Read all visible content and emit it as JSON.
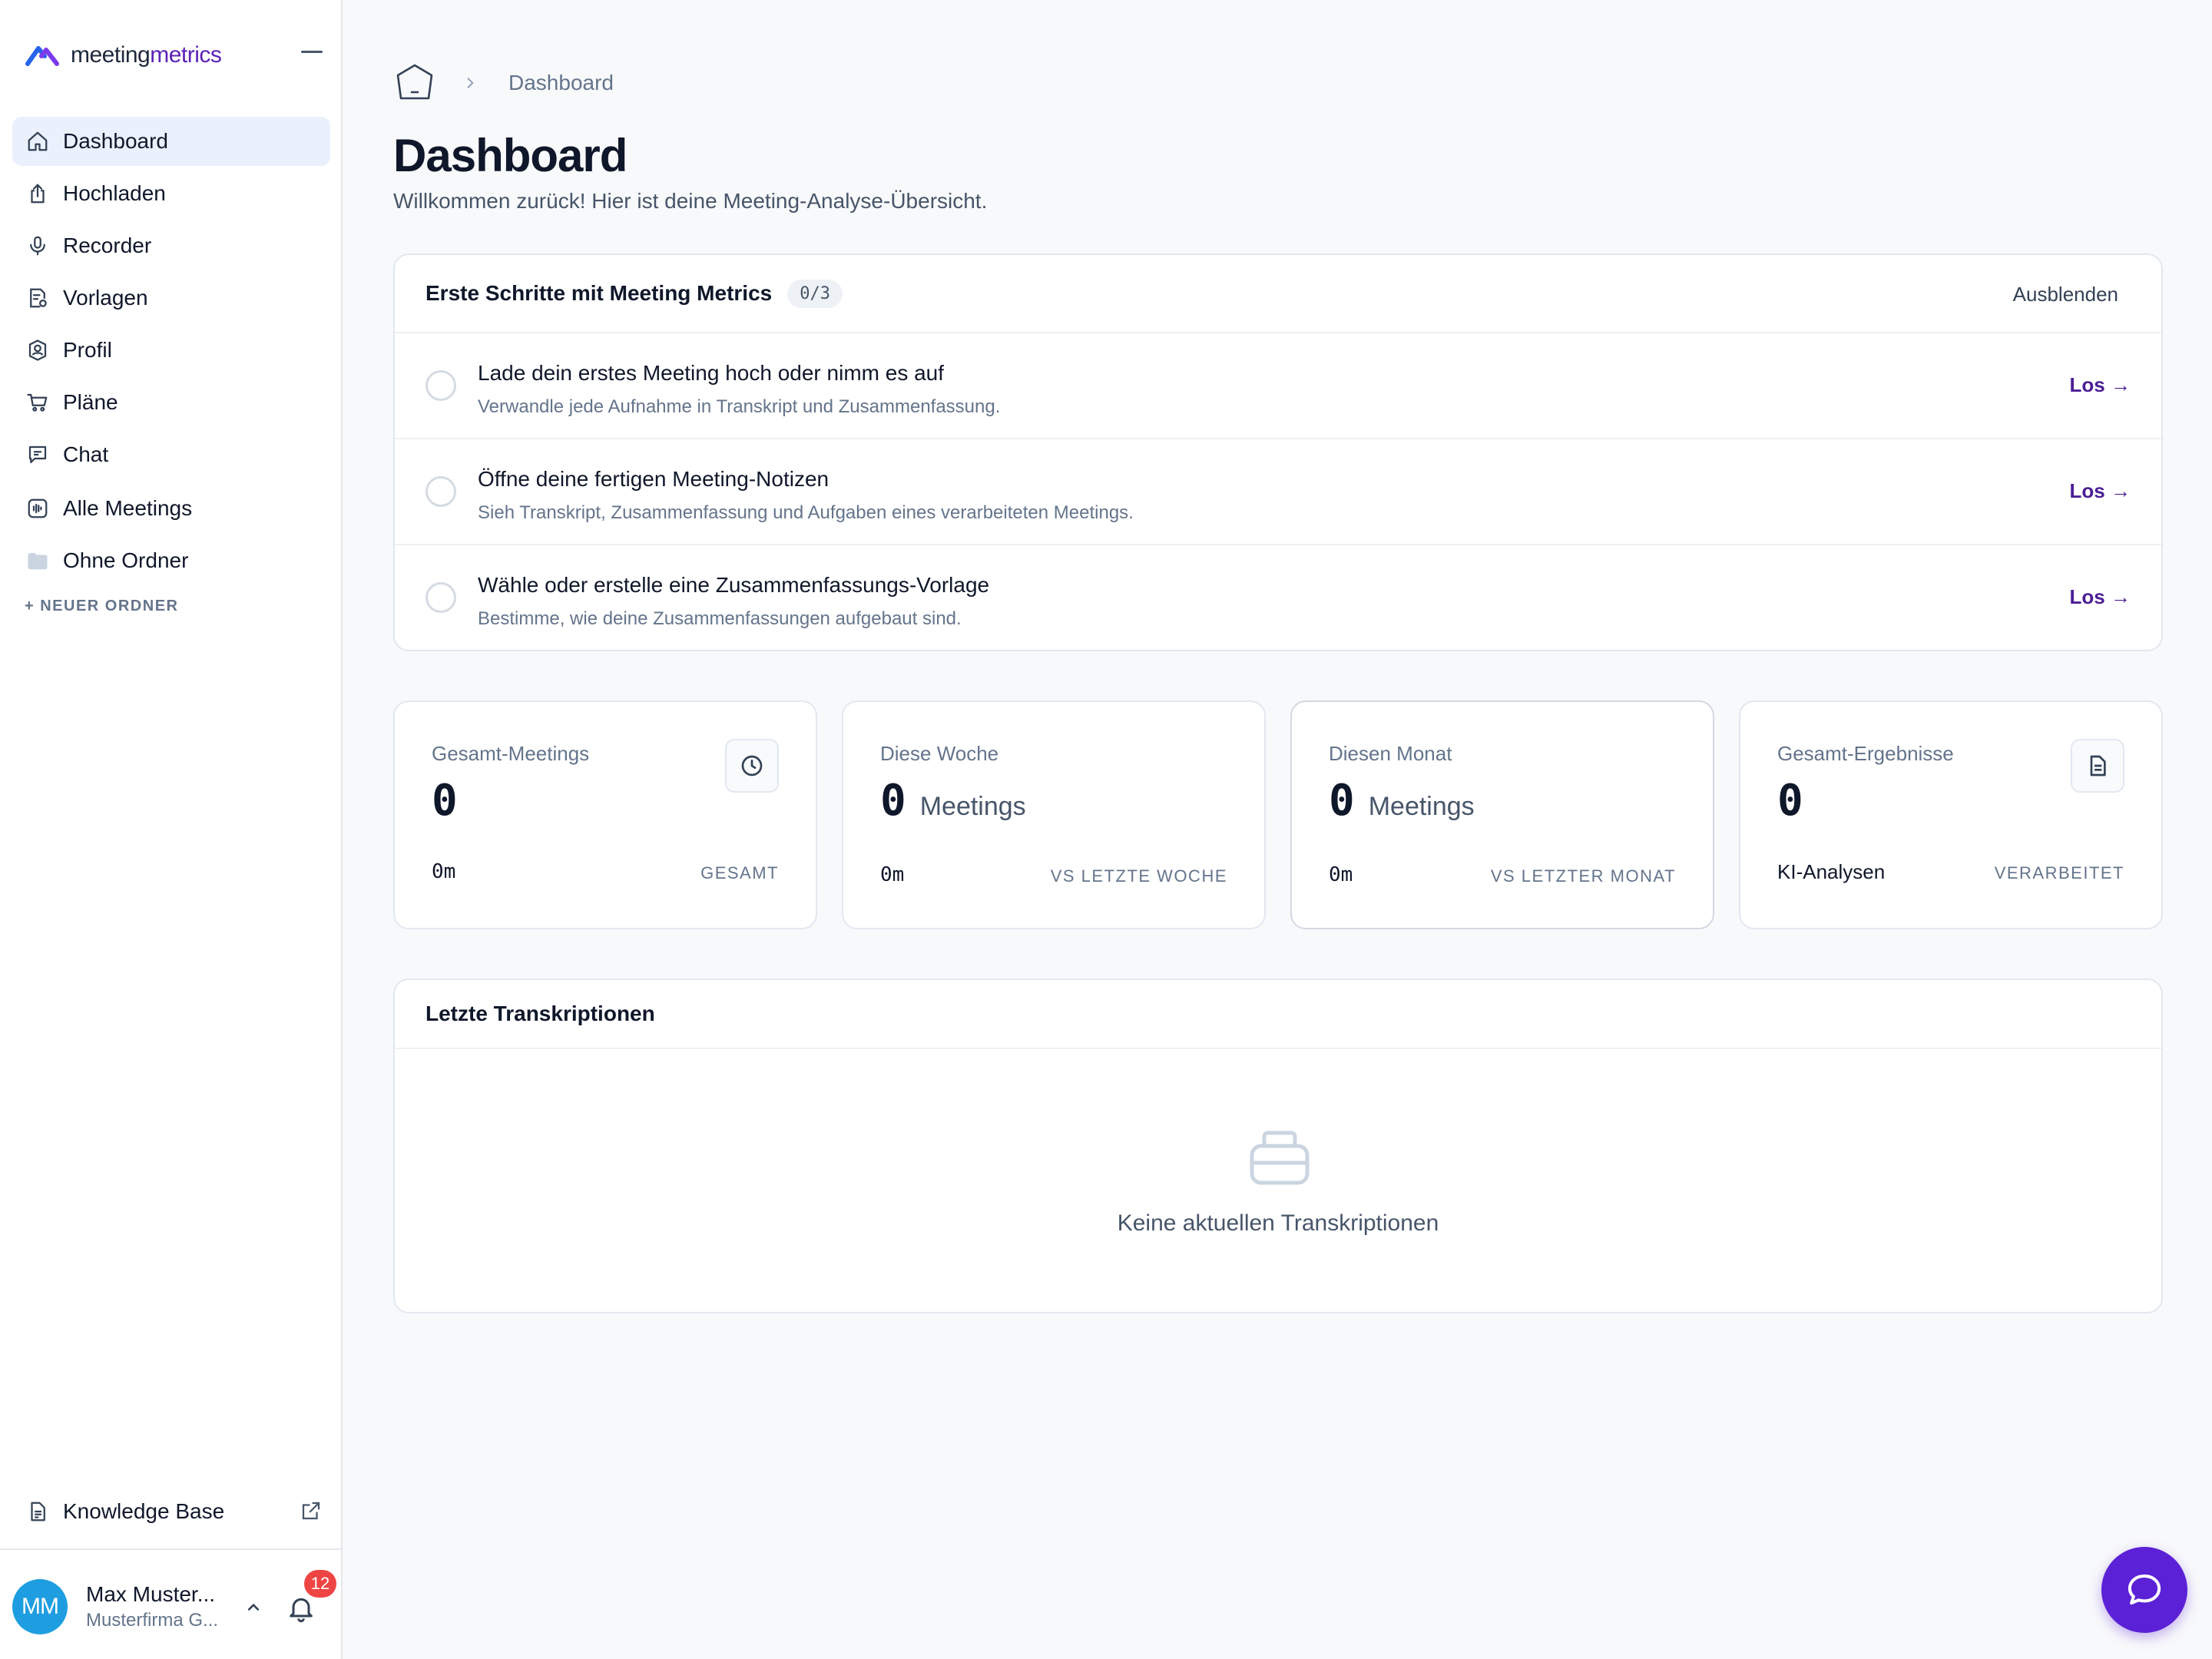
{
  "app": {
    "logo_text_a": "meeting",
    "logo_text_b": "metrics",
    "brand_color": "#5b21b6"
  },
  "sidebar": {
    "items": [
      {
        "label": "Dashboard",
        "icon": "home-icon",
        "active": true
      },
      {
        "label": "Hochladen",
        "icon": "upload-icon"
      },
      {
        "label": "Recorder",
        "icon": "microphone-icon"
      },
      {
        "label": "Vorlagen",
        "icon": "template-icon"
      },
      {
        "label": "Profil",
        "icon": "profile-icon"
      },
      {
        "label": "Pläne",
        "icon": "cart-icon"
      },
      {
        "label": "Chat",
        "icon": "chat-icon"
      },
      {
        "label": "Alle Meetings",
        "icon": "waveform-icon"
      },
      {
        "label": "Ohne Ordner",
        "icon": "folder-icon"
      }
    ],
    "new_folder": "+ NEUER ORDNER",
    "knowledge_base": "Knowledge Base",
    "user": {
      "initials": "MM",
      "name": "Max Muster...",
      "company": "Musterfirma G...",
      "notifications": "12"
    }
  },
  "breadcrumb": {
    "current": "Dashboard"
  },
  "page": {
    "title": "Dashboard",
    "subtitle": "Willkommen zurück! Hier ist deine Meeting-Analyse-Übersicht."
  },
  "getting_started": {
    "title": "Erste Schritte mit Meeting Metrics",
    "progress": "0/3",
    "hide_label": "Ausblenden",
    "steps": [
      {
        "title": "Lade dein erstes Meeting hoch oder nimm es auf",
        "desc": "Verwandle jede Aufnahme in Transkript und Zusammenfassung.",
        "action": "Los →"
      },
      {
        "title": "Öffne deine fertigen Meeting-Notizen",
        "desc": "Sieh Transkript, Zusammenfassung und Aufgaben eines verarbeiteten Meetings.",
        "action": "Los →"
      },
      {
        "title": "Wähle oder erstelle eine Zusammenfassungs-Vorlage",
        "desc": "Bestimme, wie deine Zusammenfassungen aufgebaut sind.",
        "action": "Los →"
      }
    ]
  },
  "stats": [
    {
      "label": "Gesamt-Meetings",
      "value": "0",
      "unit": "",
      "foot_left": "0m",
      "foot_right": "GESAMT",
      "icon": "clock-icon"
    },
    {
      "label": "Diese Woche",
      "value": "0",
      "unit": "Meetings",
      "foot_left": "0m",
      "foot_right": "VS LETZTE WOCHE"
    },
    {
      "label": "Diesen Monat",
      "value": "0",
      "unit": "Meetings",
      "foot_left": "0m",
      "foot_right": "VS LETZTER MONAT"
    },
    {
      "label": "Gesamt-Ergebnisse",
      "value": "0",
      "unit": "",
      "foot_left": "KI-Analysen",
      "foot_right": "VERARBEITET",
      "icon": "document-icon"
    }
  ],
  "recent": {
    "title": "Letzte Transkriptionen",
    "empty_text": "Keine aktuellen Transkriptionen"
  }
}
